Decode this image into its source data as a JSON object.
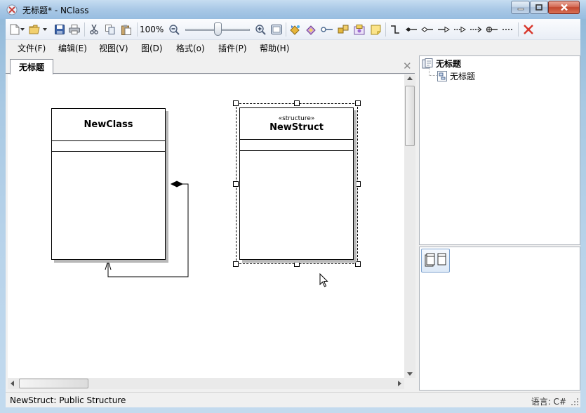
{
  "window": {
    "title": "无标题* - NClass",
    "controls": [
      "minimize",
      "maximize",
      "close"
    ]
  },
  "toolbar": {
    "zoom_label": "100%",
    "zoom_level_percent": 100,
    "buttons": [
      "new-document-icon",
      "open-folder-icon",
      "save-icon",
      "print-icon",
      "cut-icon",
      "copy-icon",
      "paste-icon",
      "zoom-out-icon",
      "zoom-in-icon",
      "auto-zoom-icon",
      "add-class-icon",
      "add-struct-icon",
      "add-interface-icon",
      "add-enum-icon",
      "add-delegate-icon",
      "add-comment-icon",
      "association-icon",
      "composition-icon",
      "aggregation-icon",
      "generalization-icon",
      "realization-icon",
      "dependency-icon",
      "nesting-icon",
      "comment-relation-icon",
      "delete-icon"
    ]
  },
  "menu": {
    "items": [
      "文件(F)",
      "编辑(E)",
      "视图(V)",
      "图(D)",
      "格式(o)",
      "插件(P)",
      "帮助(H)"
    ]
  },
  "document": {
    "tab_label": "无标题",
    "close_symbol": "✕"
  },
  "diagram": {
    "shapes": [
      {
        "kind": "class",
        "name": "NewClass",
        "stereotype": "",
        "selected": false
      },
      {
        "kind": "struct",
        "name": "NewStruct",
        "stereotype": "«structure»",
        "selected": true
      }
    ],
    "relationships": [
      {
        "type": "composition",
        "from": "NewClass",
        "to": "NewClass"
      }
    ]
  },
  "model_explorer": {
    "root": "无标题",
    "children": [
      "无标题"
    ]
  },
  "status": {
    "text": "NewStruct: Public Structure",
    "language": "语言: C#"
  },
  "colors": {
    "titlebar": "#a9c8e6",
    "close_button": "#c2472f",
    "canvas": "#ffffff",
    "shape_shadow": "#b8b8b8"
  }
}
